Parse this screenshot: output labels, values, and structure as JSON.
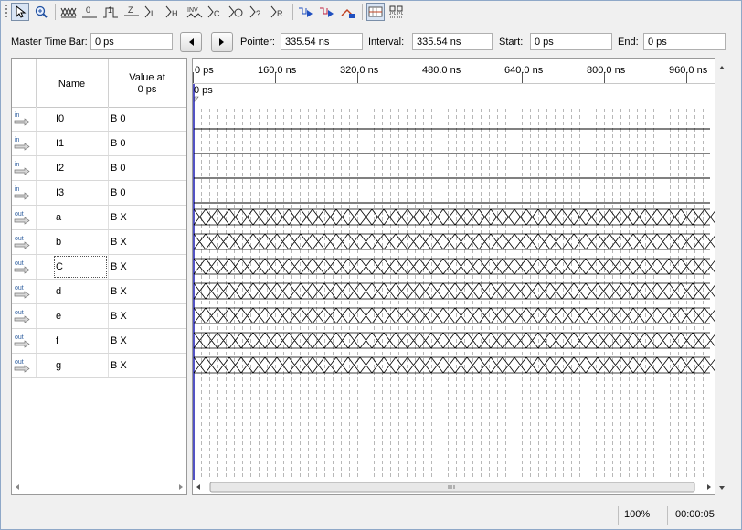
{
  "toolbar": {
    "tools": [
      "selection-tool-icon",
      "zoom-tool-icon",
      "force-unknown-icon",
      "force-low-icon",
      "force-high-icon",
      "force-high-impedance-icon",
      "force-weak-low-icon",
      "force-weak-high-icon",
      "invert-icon",
      "count-value-icon",
      "overwrite-clock-icon",
      "force-dont-care-icon",
      "random-values-icon",
      "run-functional-simulation-icon",
      "run-timing-simulation-icon",
      "generate-netlist-icon",
      "grid-snap-icon",
      "group-icon"
    ]
  },
  "controls": {
    "master_time_bar_label": "Master Time Bar:",
    "master_time_bar_value": "0 ps",
    "pointer_label": "Pointer:",
    "pointer_value": "335.54 ns",
    "interval_label": "Interval:",
    "interval_value": "335.54 ns",
    "start_label": "Start:",
    "start_value": "0 ps",
    "end_label": "End:",
    "end_value": "0 ps"
  },
  "table": {
    "col_name": "Name",
    "col_value_line1": "Value at",
    "col_value_line2": "0 ps",
    "signals": [
      {
        "dir": "in",
        "name": "I0",
        "value": "B 0",
        "wave": "low"
      },
      {
        "dir": "in",
        "name": "I1",
        "value": "B 0",
        "wave": "low"
      },
      {
        "dir": "in",
        "name": "I2",
        "value": "B 0",
        "wave": "low"
      },
      {
        "dir": "in",
        "name": "I3",
        "value": "B 0",
        "wave": "low"
      },
      {
        "dir": "out",
        "name": "a",
        "value": "B X",
        "wave": "unknown"
      },
      {
        "dir": "out",
        "name": "b",
        "value": "B X",
        "wave": "unknown"
      },
      {
        "dir": "out",
        "name": "C",
        "value": "B X",
        "wave": "unknown"
      },
      {
        "dir": "out",
        "name": "d",
        "value": "B X",
        "wave": "unknown"
      },
      {
        "dir": "out",
        "name": "e",
        "value": "B X",
        "wave": "unknown"
      },
      {
        "dir": "out",
        "name": "f",
        "value": "B X",
        "wave": "unknown"
      },
      {
        "dir": "out",
        "name": "g",
        "value": "B X",
        "wave": "unknown"
      }
    ]
  },
  "timeline": {
    "ticks": [
      "0 ps",
      "160.0 ns",
      "320.0 ns",
      "480.0 ns",
      "640.0 ns",
      "800.0 ns",
      "960.0 ns"
    ],
    "cursor_label": "0 ps"
  },
  "status": {
    "zoom": "100%",
    "elapsed": "00:00:05"
  }
}
